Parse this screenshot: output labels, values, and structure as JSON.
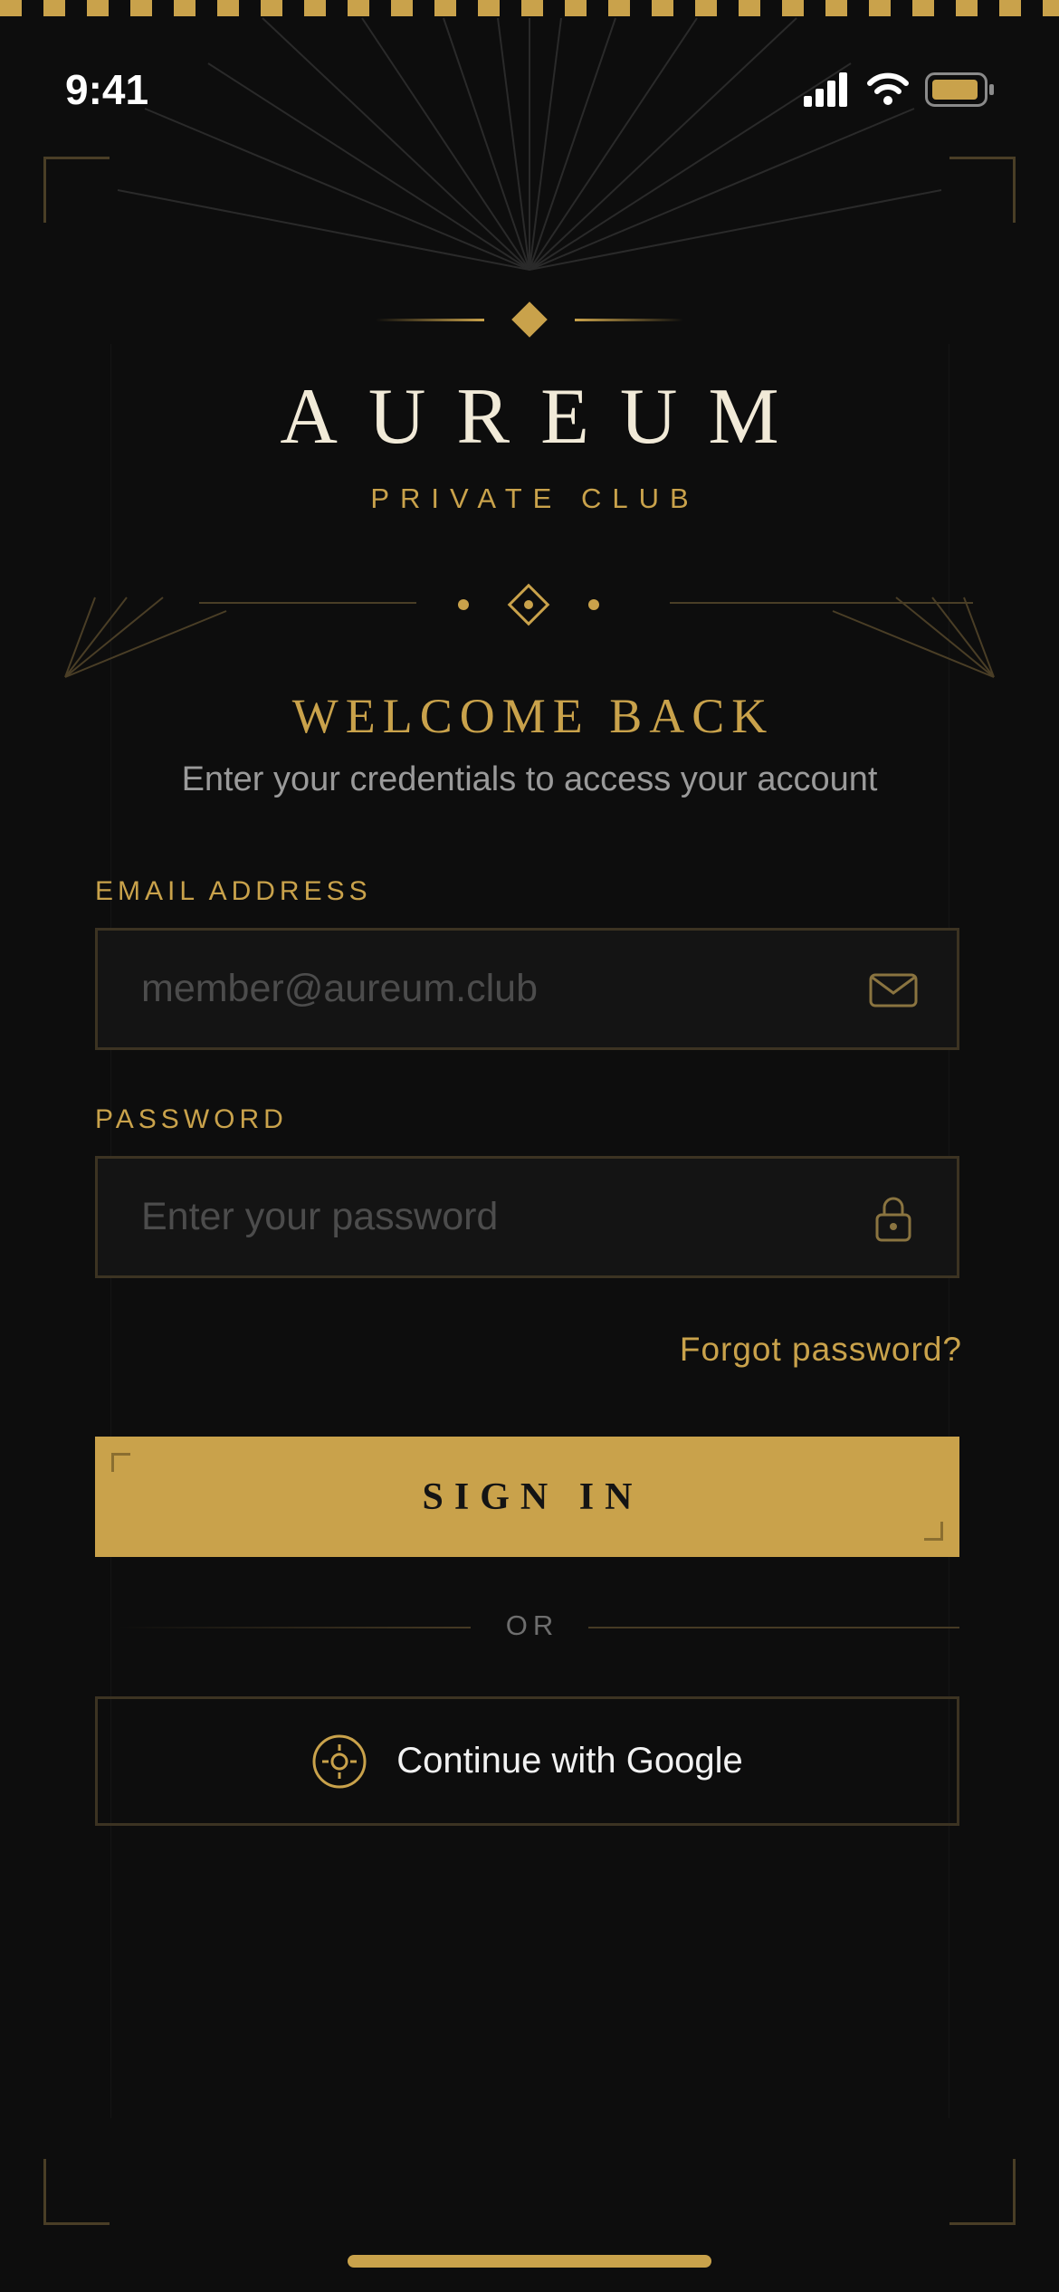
{
  "status_bar": {
    "time": "9:41"
  },
  "brand": {
    "name": "AUREUM",
    "tagline": "PRIVATE CLUB"
  },
  "header": {
    "title": "WELCOME BACK",
    "subtitle": "Enter your credentials to access your account"
  },
  "form": {
    "email": {
      "label": "EMAIL ADDRESS",
      "placeholder": "member@aureum.club",
      "value": "",
      "icon": "envelope-icon"
    },
    "password": {
      "label": "PASSWORD",
      "placeholder": "Enter your password",
      "value": "",
      "icon": "lock-icon"
    },
    "forgot_label": "Forgot password?",
    "submit_label": "SIGN IN"
  },
  "divider_label": "OR",
  "social": {
    "google_label": "Continue with Google",
    "icon": "google-crosshair-icon"
  },
  "colors": {
    "accent": "#c9a24b",
    "background": "#0d0d0d",
    "text_primary": "#f1ead8",
    "text_muted": "#9a9a9a"
  }
}
